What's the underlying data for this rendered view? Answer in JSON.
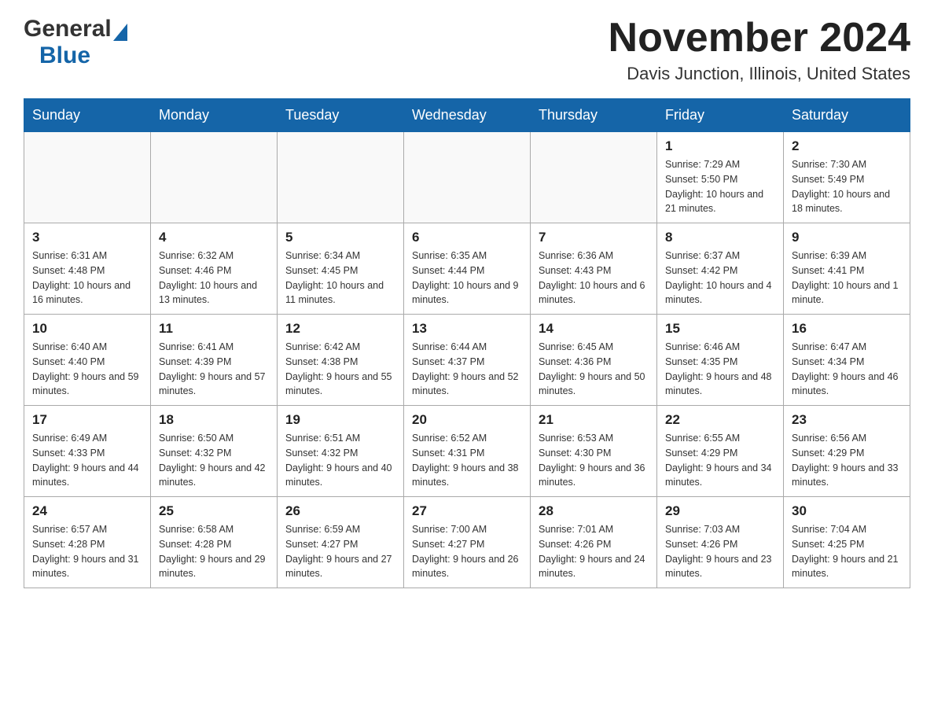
{
  "header": {
    "logo_general": "General",
    "logo_blue": "Blue",
    "month_title": "November 2024",
    "location": "Davis Junction, Illinois, United States"
  },
  "days_of_week": [
    "Sunday",
    "Monday",
    "Tuesday",
    "Wednesday",
    "Thursday",
    "Friday",
    "Saturday"
  ],
  "weeks": [
    [
      {
        "day": "",
        "sunrise": "",
        "sunset": "",
        "daylight": "",
        "empty": true
      },
      {
        "day": "",
        "sunrise": "",
        "sunset": "",
        "daylight": "",
        "empty": true
      },
      {
        "day": "",
        "sunrise": "",
        "sunset": "",
        "daylight": "",
        "empty": true
      },
      {
        "day": "",
        "sunrise": "",
        "sunset": "",
        "daylight": "",
        "empty": true
      },
      {
        "day": "",
        "sunrise": "",
        "sunset": "",
        "daylight": "",
        "empty": true
      },
      {
        "day": "1",
        "sunrise": "Sunrise: 7:29 AM",
        "sunset": "Sunset: 5:50 PM",
        "daylight": "Daylight: 10 hours and 21 minutes.",
        "empty": false
      },
      {
        "day": "2",
        "sunrise": "Sunrise: 7:30 AM",
        "sunset": "Sunset: 5:49 PM",
        "daylight": "Daylight: 10 hours and 18 minutes.",
        "empty": false
      }
    ],
    [
      {
        "day": "3",
        "sunrise": "Sunrise: 6:31 AM",
        "sunset": "Sunset: 4:48 PM",
        "daylight": "Daylight: 10 hours and 16 minutes.",
        "empty": false
      },
      {
        "day": "4",
        "sunrise": "Sunrise: 6:32 AM",
        "sunset": "Sunset: 4:46 PM",
        "daylight": "Daylight: 10 hours and 13 minutes.",
        "empty": false
      },
      {
        "day": "5",
        "sunrise": "Sunrise: 6:34 AM",
        "sunset": "Sunset: 4:45 PM",
        "daylight": "Daylight: 10 hours and 11 minutes.",
        "empty": false
      },
      {
        "day": "6",
        "sunrise": "Sunrise: 6:35 AM",
        "sunset": "Sunset: 4:44 PM",
        "daylight": "Daylight: 10 hours and 9 minutes.",
        "empty": false
      },
      {
        "day": "7",
        "sunrise": "Sunrise: 6:36 AM",
        "sunset": "Sunset: 4:43 PM",
        "daylight": "Daylight: 10 hours and 6 minutes.",
        "empty": false
      },
      {
        "day": "8",
        "sunrise": "Sunrise: 6:37 AM",
        "sunset": "Sunset: 4:42 PM",
        "daylight": "Daylight: 10 hours and 4 minutes.",
        "empty": false
      },
      {
        "day": "9",
        "sunrise": "Sunrise: 6:39 AM",
        "sunset": "Sunset: 4:41 PM",
        "daylight": "Daylight: 10 hours and 1 minute.",
        "empty": false
      }
    ],
    [
      {
        "day": "10",
        "sunrise": "Sunrise: 6:40 AM",
        "sunset": "Sunset: 4:40 PM",
        "daylight": "Daylight: 9 hours and 59 minutes.",
        "empty": false
      },
      {
        "day": "11",
        "sunrise": "Sunrise: 6:41 AM",
        "sunset": "Sunset: 4:39 PM",
        "daylight": "Daylight: 9 hours and 57 minutes.",
        "empty": false
      },
      {
        "day": "12",
        "sunrise": "Sunrise: 6:42 AM",
        "sunset": "Sunset: 4:38 PM",
        "daylight": "Daylight: 9 hours and 55 minutes.",
        "empty": false
      },
      {
        "day": "13",
        "sunrise": "Sunrise: 6:44 AM",
        "sunset": "Sunset: 4:37 PM",
        "daylight": "Daylight: 9 hours and 52 minutes.",
        "empty": false
      },
      {
        "day": "14",
        "sunrise": "Sunrise: 6:45 AM",
        "sunset": "Sunset: 4:36 PM",
        "daylight": "Daylight: 9 hours and 50 minutes.",
        "empty": false
      },
      {
        "day": "15",
        "sunrise": "Sunrise: 6:46 AM",
        "sunset": "Sunset: 4:35 PM",
        "daylight": "Daylight: 9 hours and 48 minutes.",
        "empty": false
      },
      {
        "day": "16",
        "sunrise": "Sunrise: 6:47 AM",
        "sunset": "Sunset: 4:34 PM",
        "daylight": "Daylight: 9 hours and 46 minutes.",
        "empty": false
      }
    ],
    [
      {
        "day": "17",
        "sunrise": "Sunrise: 6:49 AM",
        "sunset": "Sunset: 4:33 PM",
        "daylight": "Daylight: 9 hours and 44 minutes.",
        "empty": false
      },
      {
        "day": "18",
        "sunrise": "Sunrise: 6:50 AM",
        "sunset": "Sunset: 4:32 PM",
        "daylight": "Daylight: 9 hours and 42 minutes.",
        "empty": false
      },
      {
        "day": "19",
        "sunrise": "Sunrise: 6:51 AM",
        "sunset": "Sunset: 4:32 PM",
        "daylight": "Daylight: 9 hours and 40 minutes.",
        "empty": false
      },
      {
        "day": "20",
        "sunrise": "Sunrise: 6:52 AM",
        "sunset": "Sunset: 4:31 PM",
        "daylight": "Daylight: 9 hours and 38 minutes.",
        "empty": false
      },
      {
        "day": "21",
        "sunrise": "Sunrise: 6:53 AM",
        "sunset": "Sunset: 4:30 PM",
        "daylight": "Daylight: 9 hours and 36 minutes.",
        "empty": false
      },
      {
        "day": "22",
        "sunrise": "Sunrise: 6:55 AM",
        "sunset": "Sunset: 4:29 PM",
        "daylight": "Daylight: 9 hours and 34 minutes.",
        "empty": false
      },
      {
        "day": "23",
        "sunrise": "Sunrise: 6:56 AM",
        "sunset": "Sunset: 4:29 PM",
        "daylight": "Daylight: 9 hours and 33 minutes.",
        "empty": false
      }
    ],
    [
      {
        "day": "24",
        "sunrise": "Sunrise: 6:57 AM",
        "sunset": "Sunset: 4:28 PM",
        "daylight": "Daylight: 9 hours and 31 minutes.",
        "empty": false
      },
      {
        "day": "25",
        "sunrise": "Sunrise: 6:58 AM",
        "sunset": "Sunset: 4:28 PM",
        "daylight": "Daylight: 9 hours and 29 minutes.",
        "empty": false
      },
      {
        "day": "26",
        "sunrise": "Sunrise: 6:59 AM",
        "sunset": "Sunset: 4:27 PM",
        "daylight": "Daylight: 9 hours and 27 minutes.",
        "empty": false
      },
      {
        "day": "27",
        "sunrise": "Sunrise: 7:00 AM",
        "sunset": "Sunset: 4:27 PM",
        "daylight": "Daylight: 9 hours and 26 minutes.",
        "empty": false
      },
      {
        "day": "28",
        "sunrise": "Sunrise: 7:01 AM",
        "sunset": "Sunset: 4:26 PM",
        "daylight": "Daylight: 9 hours and 24 minutes.",
        "empty": false
      },
      {
        "day": "29",
        "sunrise": "Sunrise: 7:03 AM",
        "sunset": "Sunset: 4:26 PM",
        "daylight": "Daylight: 9 hours and 23 minutes.",
        "empty": false
      },
      {
        "day": "30",
        "sunrise": "Sunrise: 7:04 AM",
        "sunset": "Sunset: 4:25 PM",
        "daylight": "Daylight: 9 hours and 21 minutes.",
        "empty": false
      }
    ]
  ]
}
